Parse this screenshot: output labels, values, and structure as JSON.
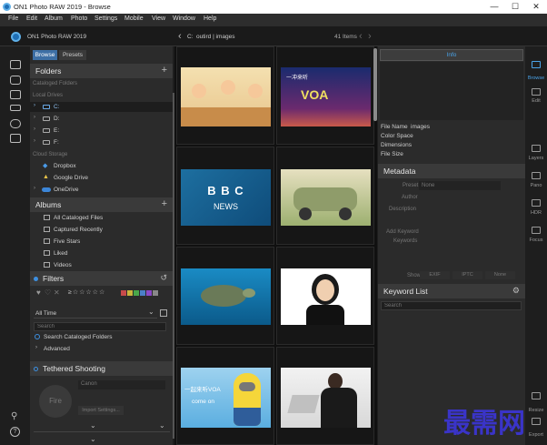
{
  "window": {
    "title": "ON1 Photo RAW 2019 - Browse",
    "controls": [
      "—",
      "☐",
      "✕"
    ]
  },
  "menu": [
    "File",
    "Edit",
    "Album",
    "Photo",
    "Settings",
    "Mobile",
    "View",
    "Window",
    "Help"
  ],
  "toolbar": {
    "app_name": "ON1 Photo RAW 2019",
    "path_drive": "C:",
    "path_folder": "outird | images",
    "item_count": "41 Items"
  },
  "left_tabs": {
    "browse": "Browse",
    "presets": "Presets"
  },
  "folders": {
    "title": "Folders",
    "cataloged": "Cataloged Folders",
    "local_drives": "Local Drives",
    "drives": [
      "C:",
      "D:",
      "E:",
      "F:"
    ],
    "cloud_storage": "Cloud Storage",
    "cloud": [
      "Dropbox",
      "Google Drive",
      "OneDrive"
    ]
  },
  "albums": {
    "title": "Albums",
    "items": [
      "All Cataloged Files",
      "Captured Recently",
      "Five Stars",
      "Liked",
      "Videos"
    ]
  },
  "filters": {
    "title": "Filters",
    "rating": "≥☆☆☆☆☆",
    "period": "All Time",
    "search_placeholder": "Search",
    "search_cataloged": "Search Cataloged Folders",
    "advanced": "Advanced",
    "swatch_colors": [
      "#c74a4a",
      "#c9b43d",
      "#4aa84a",
      "#4a7fc7",
      "#8a4ac7",
      "#888888"
    ]
  },
  "tethered": {
    "title": "Tethered Shooting",
    "fire": "Fire",
    "camera": "Canon",
    "import_settings": "Import Settings..."
  },
  "thumbnails": {
    "voa_text": "VOA",
    "voa_sub": "一冲来听",
    "bbc_line1": "B B C",
    "bbc_line2": "NEWS",
    "minion_line1": "一起来听VOA",
    "minion_line2": "come on"
  },
  "right": {
    "info_tab": "Info",
    "meta_labels": [
      "File Name",
      "Color Space",
      "Dimensions",
      "File Size"
    ],
    "file_name_value": "images",
    "metadata_title": "Metadata",
    "preset_label": "Preset",
    "preset_value": "None",
    "author_label": "Author",
    "description_label": "Description",
    "add_keyword": "Add Keyword",
    "keywords": "Keywords",
    "show_label": "Show",
    "show_options": [
      "EXIF",
      "IPTC",
      "None"
    ],
    "keyword_list_title": "Keyword List",
    "keyword_search": "Search"
  },
  "right_rail": [
    "Browse",
    "Edit",
    "Layers",
    "Pano",
    "HDR",
    "Focus",
    "Resize",
    "Export"
  ],
  "watermark": "最需网"
}
